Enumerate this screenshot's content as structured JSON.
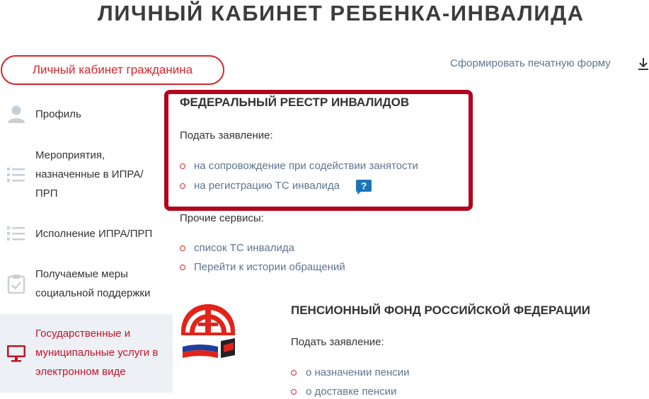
{
  "header": {
    "title": "ЛИЧНЫЙ КАБИНЕТ РЕБЕНКА-ИНВАЛИДА"
  },
  "cabinet_button": {
    "label": "Личный кабинет гражданина"
  },
  "print_form": {
    "label": "Сформировать печатную форму",
    "icon": "download-icon"
  },
  "sidebar": {
    "items": [
      {
        "label": "Профиль",
        "icon": "user-icon"
      },
      {
        "label": "Мероприятия, назначенные в ИПРА/ПРП",
        "icon": "list-icon"
      },
      {
        "label": "Исполнение ИПРА/ПРП",
        "icon": "list-icon"
      },
      {
        "label": "Получаемые меры социальной поддержки",
        "icon": "clipboard-check-icon"
      },
      {
        "label": "Государственные и муниципальные услуги в электронном виде",
        "icon": "monitor-icon",
        "active": true
      }
    ]
  },
  "fri": {
    "title": "ФЕДЕРАЛЬНЫЙ РЕЕСТР ИНВАЛИДОВ",
    "apply_label": "Подать заявление:",
    "apply_links": [
      "на сопровождение при содействии занятости",
      "на регистрацию ТС инвалида"
    ],
    "other_label": "Прочие сервисы:",
    "other_links": [
      "список ТС инвалида",
      "Перейти к истории обращений"
    ]
  },
  "pfr": {
    "title": "ПЕНСИОННЫЙ ФОНД РОССИЙСКОЙ ФЕДЕРАЦИИ",
    "apply_label": "Подать заявление:",
    "apply_links": [
      "о назначении пенсии",
      "о доставке пенсии"
    ]
  },
  "colors": {
    "accent": "#d7262c",
    "highlight": "#b2061e",
    "link": "#5d7591",
    "help": "#1a75b8"
  }
}
